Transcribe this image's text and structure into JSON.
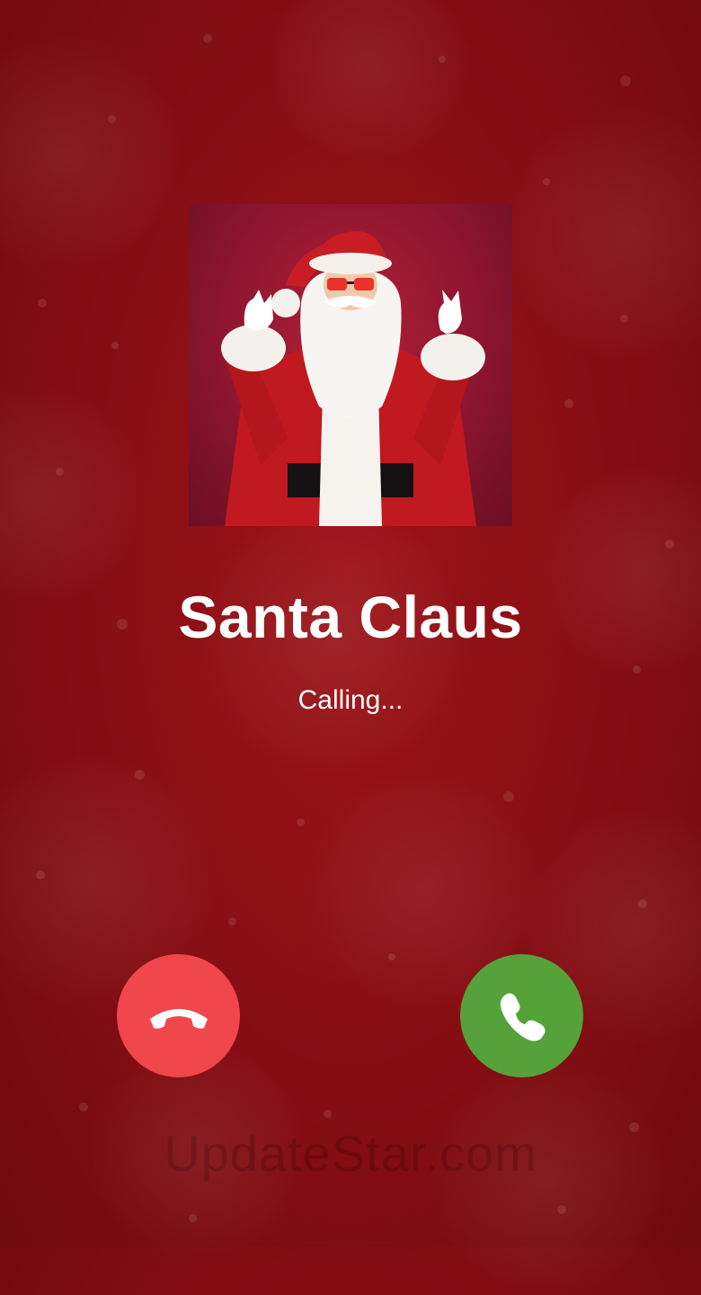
{
  "caller": {
    "name": "Santa Claus",
    "status": "Calling..."
  },
  "buttons": {
    "decline": {
      "icon": "phone-hangup-icon",
      "color": "#ef474b"
    },
    "accept": {
      "icon": "phone-answer-icon",
      "color": "#55a23a"
    }
  },
  "watermark": "UpdateStar.com",
  "colors": {
    "background": "#8a0f14",
    "text": "#ffffff"
  }
}
